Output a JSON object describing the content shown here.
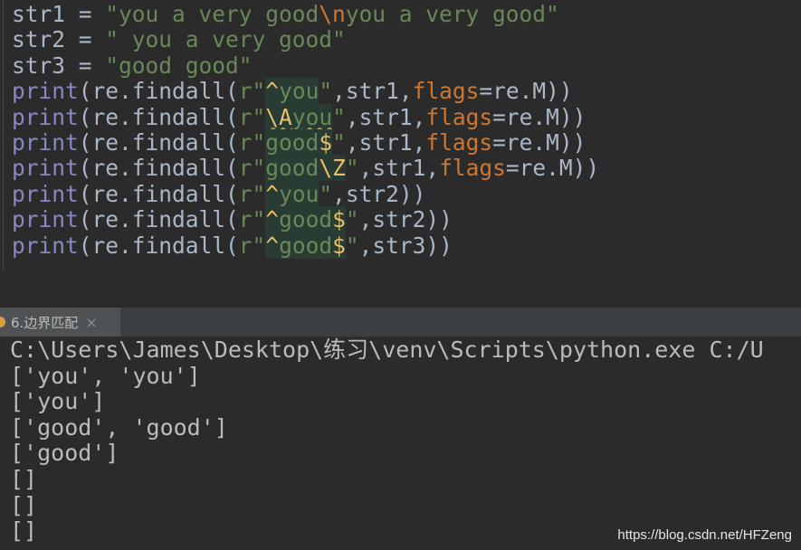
{
  "editor": {
    "lines": [
      [
        {
          "t": "str1 = ",
          "c": ""
        },
        {
          "t": "\"you a very good",
          "c": "str"
        },
        {
          "t": "\\n",
          "c": "esc"
        },
        {
          "t": "you a very good\"",
          "c": "str"
        }
      ],
      [
        {
          "t": "str2 = ",
          "c": ""
        },
        {
          "t": "\" you a very good\"",
          "c": "str"
        }
      ],
      [
        {
          "t": "str3 = ",
          "c": ""
        },
        {
          "t": "\"good good\"",
          "c": "str"
        }
      ],
      [
        {
          "t": "print",
          "c": "fn"
        },
        {
          "t": "(re.findall(",
          "c": ""
        },
        {
          "t": "r\"",
          "c": "str"
        },
        {
          "t": "^",
          "c": "rx anc"
        },
        {
          "t": "you",
          "c": "rx"
        },
        {
          "t": "\"",
          "c": "str"
        },
        {
          "t": ",str1,",
          "c": ""
        },
        {
          "t": "flags",
          "c": "kw"
        },
        {
          "t": "=re.M))",
          "c": ""
        }
      ],
      [
        {
          "t": "print",
          "c": "fn"
        },
        {
          "t": "(re.findall(",
          "c": ""
        },
        {
          "t": "r\"",
          "c": "str"
        },
        {
          "t": "\\A",
          "c": "rx anc wavy"
        },
        {
          "t": "you",
          "c": "rx wavy"
        },
        {
          "t": "\"",
          "c": "str"
        },
        {
          "t": ",str1,",
          "c": ""
        },
        {
          "t": "flags",
          "c": "kw"
        },
        {
          "t": "=re.M))",
          "c": ""
        }
      ],
      [
        {
          "t": "print",
          "c": "fn"
        },
        {
          "t": "(re.findall(",
          "c": ""
        },
        {
          "t": "r\"",
          "c": "str"
        },
        {
          "t": "good",
          "c": "rx"
        },
        {
          "t": "$",
          "c": "rx anc"
        },
        {
          "t": "\"",
          "c": "str"
        },
        {
          "t": ",str1,",
          "c": ""
        },
        {
          "t": "flags",
          "c": "kw"
        },
        {
          "t": "=re.M))",
          "c": ""
        }
      ],
      [
        {
          "t": "print",
          "c": "fn"
        },
        {
          "t": "(re.findall(",
          "c": ""
        },
        {
          "t": "r\"",
          "c": "str"
        },
        {
          "t": "good",
          "c": "rx"
        },
        {
          "t": "\\Z",
          "c": "rx anc"
        },
        {
          "t": "\"",
          "c": "str"
        },
        {
          "t": ",str1,",
          "c": ""
        },
        {
          "t": "flags",
          "c": "kw"
        },
        {
          "t": "=re.M))",
          "c": ""
        }
      ],
      [
        {
          "t": "print",
          "c": "fn"
        },
        {
          "t": "(re.findall(",
          "c": ""
        },
        {
          "t": "r\"",
          "c": "str"
        },
        {
          "t": "^",
          "c": "rx anc"
        },
        {
          "t": "you",
          "c": "rx"
        },
        {
          "t": "\"",
          "c": "str"
        },
        {
          "t": ",str2))",
          "c": ""
        }
      ],
      [
        {
          "t": "print",
          "c": "fn"
        },
        {
          "t": "(re.findall(",
          "c": ""
        },
        {
          "t": "r\"",
          "c": "str"
        },
        {
          "t": "^",
          "c": "rx anc"
        },
        {
          "t": "good",
          "c": "rx"
        },
        {
          "t": "$",
          "c": "rx anc"
        },
        {
          "t": "\"",
          "c": "str"
        },
        {
          "t": ",str2))",
          "c": ""
        }
      ],
      [
        {
          "t": "print",
          "c": "fn"
        },
        {
          "t": "(re.findall(",
          "c": ""
        },
        {
          "t": "r\"",
          "c": "str"
        },
        {
          "t": "^",
          "c": "rx anc"
        },
        {
          "t": "good",
          "c": "rx"
        },
        {
          "t": "$",
          "c": "rx anc"
        },
        {
          "t": "\"",
          "c": "str"
        },
        {
          "t": ",str3))",
          "c": ""
        }
      ]
    ]
  },
  "run_tab": {
    "label": "6.边界匹配",
    "close_glyph": "×"
  },
  "console": {
    "lines": [
      "C:\\Users\\James\\Desktop\\练习\\venv\\Scripts\\python.exe C:/U",
      "['you', 'you']",
      "['you']",
      "['good', 'good']",
      "['good']",
      "[]",
      "[]",
      "[]"
    ]
  },
  "watermark": "https://blog.csdn.net/HFZeng",
  "colors": {
    "background": "#2b2b2b",
    "default_text": "#a9b7c6",
    "string": "#6a8759",
    "keyword": "#cc7832",
    "builtin": "#8888c6",
    "regex_anchor": "#e8bf6a",
    "regex_bg": "#293c33"
  }
}
